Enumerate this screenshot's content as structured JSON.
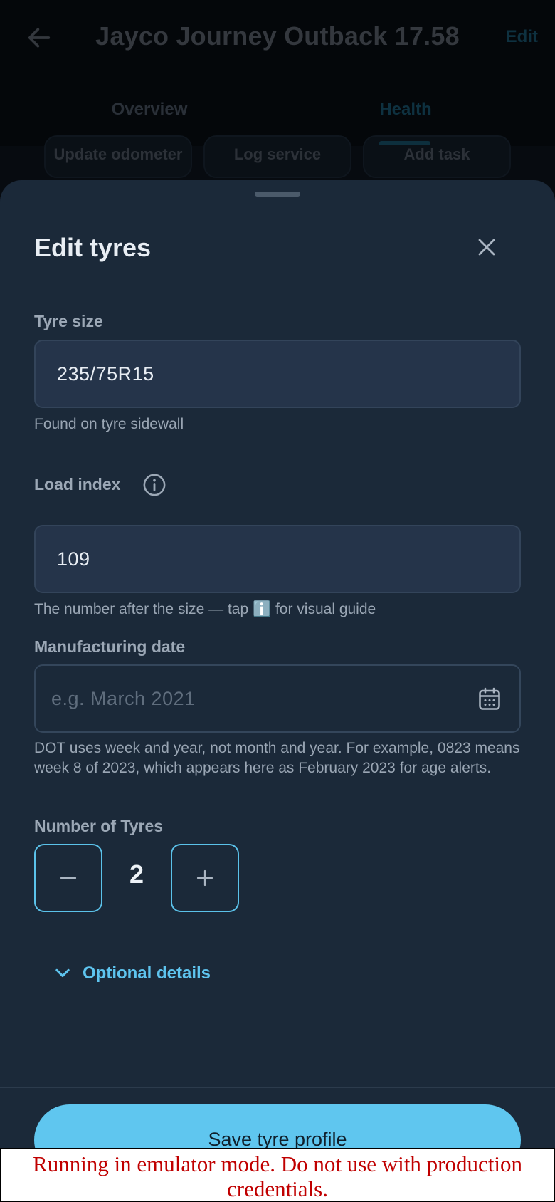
{
  "app_bar": {
    "title": "Jayco Journey Outback 17.58",
    "edit_label": "Edit",
    "back_icon": "arrow-left-icon"
  },
  "tabs": [
    {
      "label": "Overview",
      "active": false
    },
    {
      "label": "Health",
      "active": true
    }
  ],
  "quick_actions": [
    {
      "label": "Update odometer"
    },
    {
      "label": "Log service"
    },
    {
      "label": "Add task"
    }
  ],
  "sheet": {
    "title": "Edit tyres",
    "close_icon": "close-icon",
    "tyre_size": {
      "label": "Tyre size",
      "value": "235/75R15",
      "helper": "Found on tyre sidewall"
    },
    "load_index": {
      "label": "Load index",
      "info_icon": "info-icon",
      "value": "109",
      "helper": "The number after the size — tap ℹ️ for visual guide"
    },
    "manufacturing_date": {
      "label": "Manufacturing date",
      "placeholder": "e.g. March 2021",
      "value": "",
      "calendar_icon": "calendar-icon",
      "helper": "DOT uses week and year, not month and year. For example, 0823 means week 8 of 2023, which appears here as February 2023 for age alerts."
    },
    "number_of_tyres": {
      "label": "Number of Tyres",
      "value": "2",
      "minus_icon": "minus-icon",
      "plus_icon": "plus-icon"
    },
    "optional_details": {
      "label": "Optional details",
      "icon": "chevron-down-icon"
    },
    "save_label": "Save tyre profile"
  },
  "banner": {
    "text": "Running in emulator mode. Do not use with production credentials."
  },
  "colors": {
    "accent": "#5fc6ef",
    "sheet_bg": "#1b2939",
    "banner_text": "#c00000"
  }
}
